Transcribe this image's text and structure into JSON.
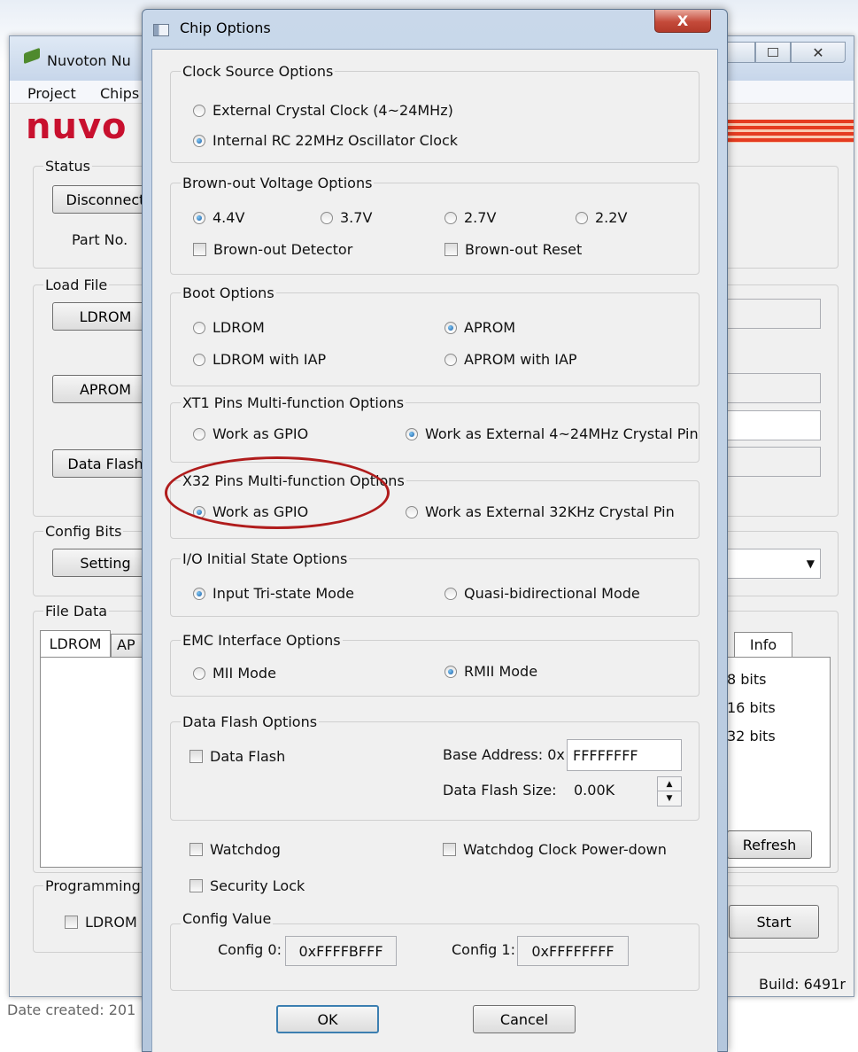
{
  "main_window": {
    "title": "Nuvoton Nu",
    "menu": [
      "Project",
      "Chips"
    ],
    "logo": "nuvo",
    "status_group": "Status",
    "disconnect_button": "Disconnect",
    "part_no_label": "Part No.",
    "load_file_group": "Load File",
    "ldrom_button": "LDROM",
    "aprom_button": "APROM",
    "dataflash_button": "Data Flash",
    "config_bits_group": "Config Bits",
    "setting_button": "Setting",
    "file_data_group": "File Data",
    "tabs": [
      "LDROM",
      "AP"
    ],
    "info_tab": "Info",
    "bit_options": [
      "8 bits",
      "16 bits",
      "32 bits"
    ],
    "refresh_button": "Refresh",
    "programming_group": "Programming",
    "programming_ldrom": "LDROM",
    "start_button": "Start",
    "build": "Build: 6491r",
    "bottom_text": "Date created: 201"
  },
  "dialog": {
    "title": "Chip Options",
    "close_label": "X",
    "clock": {
      "title": "Clock Source Options",
      "opt1": "External Crystal Clock (4~24MHz)",
      "opt2": "Internal RC 22MHz Oscillator Clock"
    },
    "brownout": {
      "title": "Brown-out Voltage Options",
      "v1": "4.4V",
      "v2": "3.7V",
      "v3": "2.7V",
      "v4": "2.2V",
      "detector": "Brown-out Detector",
      "reset": "Brown-out Reset"
    },
    "boot": {
      "title": "Boot Options",
      "ldrom": "LDROM",
      "aprom": "APROM",
      "ldrom_iap": "LDROM with IAP",
      "aprom_iap": "APROM with IAP"
    },
    "xt1": {
      "title": "XT1 Pins Multi-function Options",
      "gpio": "Work as GPIO",
      "external": "Work as External 4~24MHz Crystal Pin"
    },
    "x32": {
      "title": "X32 Pins Multi-function Options",
      "gpio": "Work as GPIO",
      "external": "Work as External 32KHz Crystal Pin"
    },
    "io": {
      "title": "I/O Initial State Options",
      "tristate": "Input Tri-state Mode",
      "quasi": "Quasi-bidirectional Mode"
    },
    "emc": {
      "title": "EMC Interface Options",
      "mii": "MII Mode",
      "rmii": "RMII Mode"
    },
    "dataflash": {
      "title": "Data Flash Options",
      "checkbox": "Data Flash",
      "base_label": "Base Address: 0x",
      "base_value": "FFFFFFFF",
      "size_label": "Data Flash Size:",
      "size_value": "0.00K"
    },
    "watchdog": "Watchdog",
    "watchdog_pd": "Watchdog Clock Power-down",
    "security_lock": "Security Lock",
    "config": {
      "title": "Config Value",
      "c0_label": "Config 0:",
      "c0_value": "0xFFFFBFFF",
      "c1_label": "Config 1:",
      "c1_value": "0xFFFFFFFF"
    },
    "ok": "OK",
    "cancel": "Cancel"
  },
  "colors": {
    "highlight_ellipse": "#b01c1c",
    "logo": "#c8102e",
    "dialog_bg": "#f0f0f0",
    "close_button": "#c44a3a"
  }
}
